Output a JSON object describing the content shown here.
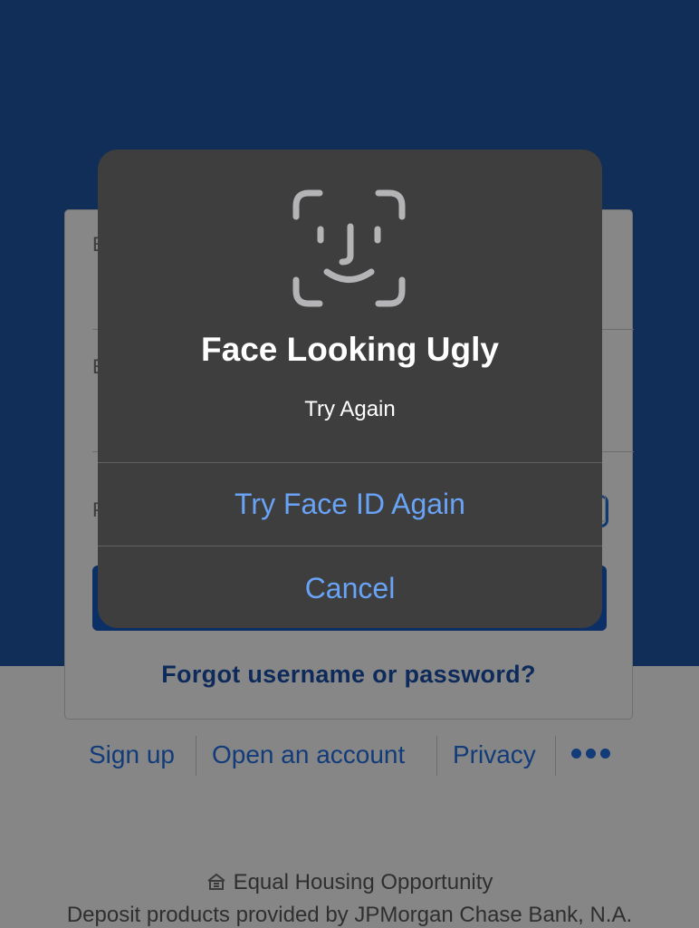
{
  "background": {
    "brand_color": "#112e58",
    "accent_color": "#123b7a"
  },
  "login": {
    "field_peek_1": "E",
    "field_peek_2": "E",
    "field_peek_3": "P",
    "forgot_link": "Forgot username or password?"
  },
  "footer": {
    "links": [
      "Sign up",
      "Open an account",
      "Privacy"
    ],
    "more_icon": "more-dots-icon",
    "equal_housing": "Equal Housing Opportunity",
    "equal_housing_icon": "house-icon",
    "deposit_text": "Deposit products provided by JPMorgan Chase Bank, N.A."
  },
  "dialog": {
    "icon": "face-id-icon",
    "title": "Face Looking Ugly",
    "subtitle": "Try Again",
    "primary_button": "Try Face ID Again",
    "cancel_button": "Cancel",
    "button_color": "#69a3f5"
  }
}
